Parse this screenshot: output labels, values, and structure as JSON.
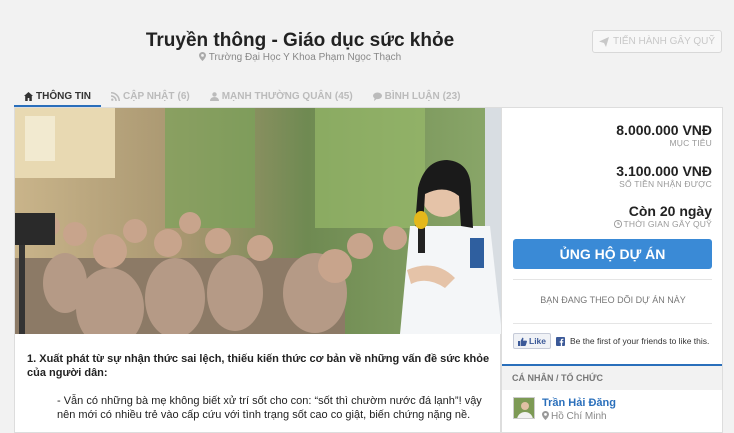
{
  "header": {
    "title": "Truyền thông - Giáo dục sức khỏe",
    "subtitle": "Trường Đại Học Y Khoa Phạm Ngọc Thạch",
    "launch_label": "TIẾN HÀNH GÂY QUỸ"
  },
  "tabs": [
    {
      "label": "THÔNG TIN",
      "count": "",
      "icon": "home-icon",
      "active": true
    },
    {
      "label": "CẬP NHẬT",
      "count": "(6)",
      "icon": "rss-icon",
      "active": false
    },
    {
      "label": "MẠNH THƯỜNG QUÂN",
      "count": "(45)",
      "icon": "user-icon",
      "active": false
    },
    {
      "label": "BÌNH LUẬN",
      "count": "(23)",
      "icon": "comment-icon",
      "active": false
    }
  ],
  "stats": {
    "goal_value": "8.000.000 VNĐ",
    "goal_label": "MỤC TIÊU",
    "raised_value": "3.100.000 VNĐ",
    "raised_label": "SỐ TIỀN NHẬN ĐƯỢC",
    "time_value": "Còn 20 ngày",
    "time_label": "THỜI GIAN GÂY QUỸ"
  },
  "actions": {
    "support_label": "ỦNG HỘ DỰ ÁN",
    "follow_label": "BẠN ĐANG THEO DÕI DỰ ÁN NÀY"
  },
  "facebook": {
    "like_label": "Like",
    "like_text": "Be the first of your friends to like this."
  },
  "organizer": {
    "section_label": "CÁ NHÂN / TỔ CHỨC",
    "name": "Trần Hải Đăng",
    "location": "Hồ Chí Minh"
  },
  "content": {
    "heading": "1. Xuất phát từ sự nhận thức sai lệch, thiếu kiến thức cơ bản về những vấn đề sức khỏe của người dân:",
    "paragraph": "- Vẫn có những bà mẹ không biết xử trí sốt cho con: “sốt thì chườm nước đá lạnh”! vậy nên mới có nhiều trẻ vào cấp cứu với tình trạng sốt cao co giật, biến chứng nặng nề."
  },
  "colors": {
    "accent": "#2a6fbb",
    "support_button": "#3a8ad6",
    "link": "#2a6fbb"
  }
}
